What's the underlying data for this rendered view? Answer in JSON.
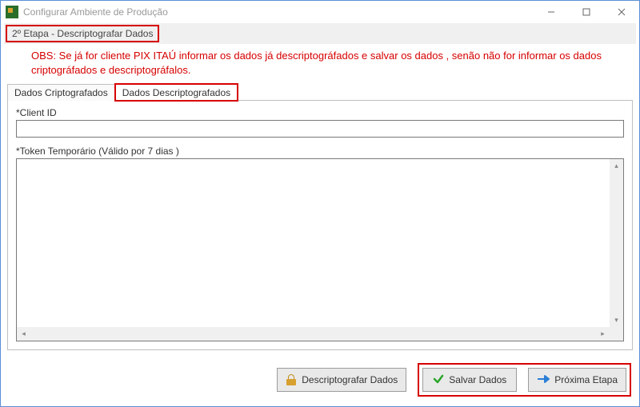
{
  "window": {
    "title": "Configurar Ambiente de Produção"
  },
  "stage": {
    "label": "2º Etapa - Descriptografar Dados"
  },
  "obs": {
    "text": "OBS: Se já for cliente PIX ITAÚ informar os dados já descriptográfados e salvar os dados , senão não for informar os dados criptográfados e descriptográfalos."
  },
  "tabs": {
    "encrypted": "Dados Criptografados",
    "decrypted": "Dados Descriptografados"
  },
  "fields": {
    "client_id_label": "*Client ID",
    "client_id_value": "",
    "token_label": "*Token Temporário (Válido por 7 dias )",
    "token_value": ""
  },
  "buttons": {
    "decrypt": "Descriptografar Dados",
    "save": "Salvar Dados",
    "next": "Próxima Etapa"
  }
}
